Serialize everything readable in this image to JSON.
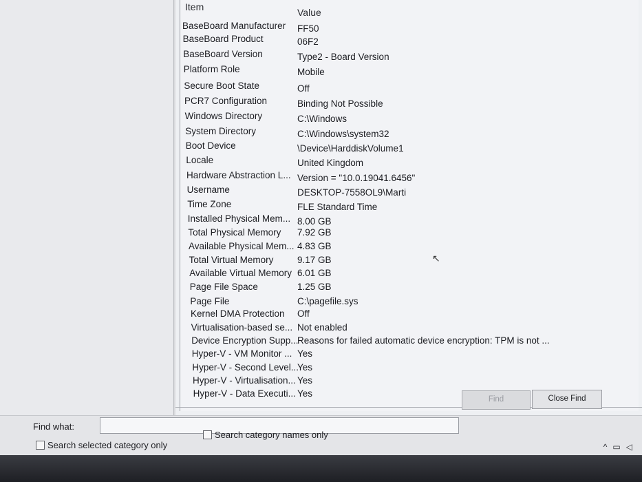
{
  "columns": {
    "item": "Item",
    "value": "Value"
  },
  "rows": [
    {
      "item": "BaseBoard Manufacturer",
      "value": "FF50"
    },
    {
      "item": "BaseBoard Product",
      "value": "06F2"
    },
    {
      "item": "BaseBoard Version",
      "value": "Type2 - Board Version"
    },
    {
      "item": "Platform Role",
      "value": "Mobile"
    },
    {
      "item": "Secure Boot State",
      "value": "Off"
    },
    {
      "item": "PCR7 Configuration",
      "value": "Binding Not Possible"
    },
    {
      "item": "Windows Directory",
      "value": "C:\\Windows"
    },
    {
      "item": "System Directory",
      "value": "C:\\Windows\\system32"
    },
    {
      "item": "Boot Device",
      "value": "\\Device\\HarddiskVolume1"
    },
    {
      "item": "Locale",
      "value": "United Kingdom"
    },
    {
      "item": "Hardware Abstraction L...",
      "value": "Version = \"10.0.19041.6456\""
    },
    {
      "item": "Username",
      "value": "DESKTOP-7558OL9\\Marti"
    },
    {
      "item": "Time Zone",
      "value": "FLE Standard Time"
    },
    {
      "item": "Installed Physical Mem...",
      "value": "8.00 GB"
    },
    {
      "item": "Total Physical Memory",
      "value": "7.92 GB"
    },
    {
      "item": "Available Physical Mem...",
      "value": "4.83 GB"
    },
    {
      "item": "Total Virtual Memory",
      "value": "9.17 GB"
    },
    {
      "item": "Available Virtual Memory",
      "value": "6.01 GB"
    },
    {
      "item": "Page File Space",
      "value": "1.25 GB"
    },
    {
      "item": "Page File",
      "value": "C:\\pagefile.sys"
    },
    {
      "item": "Kernel DMA Protection",
      "value": "Off"
    },
    {
      "item": "Virtualisation-based se...",
      "value": "Not enabled"
    },
    {
      "item": "Device Encryption Supp...",
      "value": "Reasons for failed automatic device encryption: TPM is not ..."
    },
    {
      "item": "Hyper-V - VM Monitor ...",
      "value": "Yes"
    },
    {
      "item": "Hyper-V - Second Level...",
      "value": "Yes"
    },
    {
      "item": "Hyper-V - Virtualisation...",
      "value": "Yes"
    },
    {
      "item": "Hyper-V - Data Executi...",
      "value": "Yes"
    }
  ],
  "find": {
    "label": "Find what:",
    "value": "",
    "find_button": "Find",
    "close_button": "Close Find",
    "search_selected_label": "Search selected category only",
    "search_names_label": "Search category names only",
    "search_selected_checked": false,
    "search_names_checked": false
  },
  "tray": {
    "chevron": "^",
    "network": "▭",
    "volume": "◁"
  },
  "colors": {
    "window_bg": "#f2f3f6",
    "disabled_text": "#9a9ca2"
  }
}
